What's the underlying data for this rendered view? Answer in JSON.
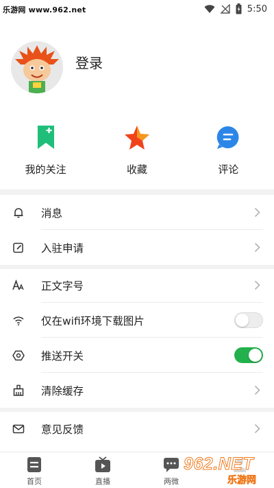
{
  "status_bar": {
    "watermark": "乐游网 www.962.net",
    "time": "5:50",
    "icons": [
      "wifi-icon",
      "signal-icon",
      "battery-icon"
    ]
  },
  "profile": {
    "login_label": "登录"
  },
  "quick_actions": [
    {
      "label": "我的关注",
      "icon": "bookmark-plus-icon",
      "color": "#1fbf7a"
    },
    {
      "label": "收藏",
      "icon": "star-icon",
      "color": "#f0431c"
    },
    {
      "label": "评论",
      "icon": "comment-icon",
      "color": "#2b86e8"
    }
  ],
  "menu": {
    "messages": "消息",
    "apply": "入驻申请",
    "font_size": "正文字号",
    "wifi_images": "仅在wifi环境下载图片",
    "push": "推送开关",
    "clear_cache": "清除缓存",
    "feedback": "意见反馈"
  },
  "toggles": {
    "wifi_images_on": false,
    "push_on": true
  },
  "tabbar": [
    {
      "label": "首页",
      "icon": "home-doc-icon"
    },
    {
      "label": "直播",
      "icon": "tv-play-icon"
    },
    {
      "label": "两微",
      "icon": "chat-icon"
    },
    {
      "label": "",
      "icon": "me-icon"
    }
  ],
  "overlay_watermark": {
    "line1": "962.NET",
    "line2": "乐游网"
  },
  "colors": {
    "toggle_on": "#22b14c",
    "section_gap": "#f2f2f2"
  }
}
